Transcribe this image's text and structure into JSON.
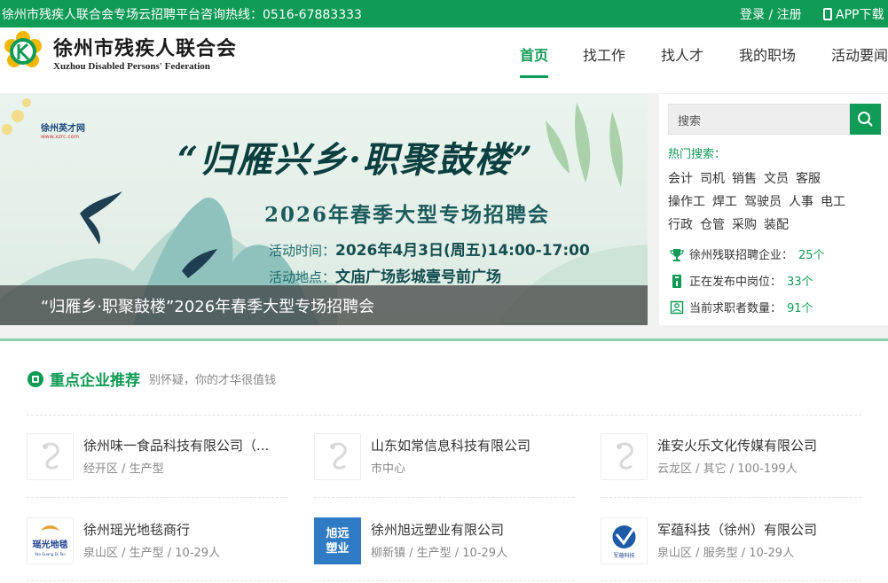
{
  "topbar": {
    "hotline": "徐州市残疾人联合会专场云招聘平台咨询热线：0516-67883333",
    "login": "登录 / 注册",
    "app": "APP下载"
  },
  "header": {
    "org_cn": "徐州市残疾人联合会",
    "org_en": "Xuzhou Disabled Persons' Federation",
    "nav": [
      {
        "label": "首页",
        "active": true
      },
      {
        "label": "找工作"
      },
      {
        "label": "找人才"
      },
      {
        "label": "我的职场"
      },
      {
        "label": "活动要闻"
      }
    ]
  },
  "banner": {
    "site_logo_text": "徐州英才网",
    "site_logo_sub": "www.xzrc.com",
    "slogan": "“归雁兴乡·职聚鼓楼”",
    "subtitle": "2026年春季大型专场招聘会",
    "time_label": "活动时间：",
    "time_value": "2026年4月3日(周五)14:00-17:00",
    "place_label": "活动地点：",
    "place_value": "文庙广场彭城壹号前广场",
    "caption": "“归雁乡·职聚鼓楼”2026年春季大型专场招聘会"
  },
  "side": {
    "search_placeholder": "搜索",
    "hot_label": "热门搜索：",
    "hot_rows": [
      [
        "会计",
        "司机",
        "销售",
        "文员",
        "客服"
      ],
      [
        "操作工",
        "焊工",
        "驾驶员",
        "人事",
        "电工"
      ],
      [
        "行政",
        "仓管",
        "采购",
        "装配"
      ]
    ],
    "stats": [
      {
        "label": "徐州残联招聘企业：",
        "value": "25个"
      },
      {
        "label": "正在发布中岗位：",
        "value": "33个"
      },
      {
        "label": "当前求职者数量：",
        "value": "91个"
      }
    ]
  },
  "companies_section": {
    "title": "重点企业推荐",
    "subtitle": "别怀疑，你的才华很值钱",
    "items": [
      {
        "name": "徐州味一食品科技有限公司（...",
        "meta": "经开区 / 生产型",
        "logo": "default"
      },
      {
        "name": "山东如常信息科技有限公司",
        "meta": "市中心",
        "logo": "default"
      },
      {
        "name": "淮安火乐文化传媒有限公司",
        "meta": "云龙区 / 其它 / 100-199人",
        "logo": "default"
      },
      {
        "name": "徐州瑶光地毯商行",
        "meta": "泉山区 / 生产型 / 10-29人",
        "logo": "yaoguang",
        "logo_text": "瑶光地毯",
        "logo_sub": "Yao Guang Di Tan"
      },
      {
        "name": "徐州旭远塑业有限公司",
        "meta": "柳新镇 / 生产型 / 10-29人",
        "logo": "xuyuan",
        "logo_text": "旭远塑业"
      },
      {
        "name": "军蕴科技（徐州）有限公司",
        "meta": "泉山区 / 服务型 / 10-29人",
        "logo": "junyun",
        "logo_text": "军蕴科技"
      }
    ]
  },
  "colors": {
    "brand": "#0f9a55",
    "topbar": "#0f9a55"
  }
}
